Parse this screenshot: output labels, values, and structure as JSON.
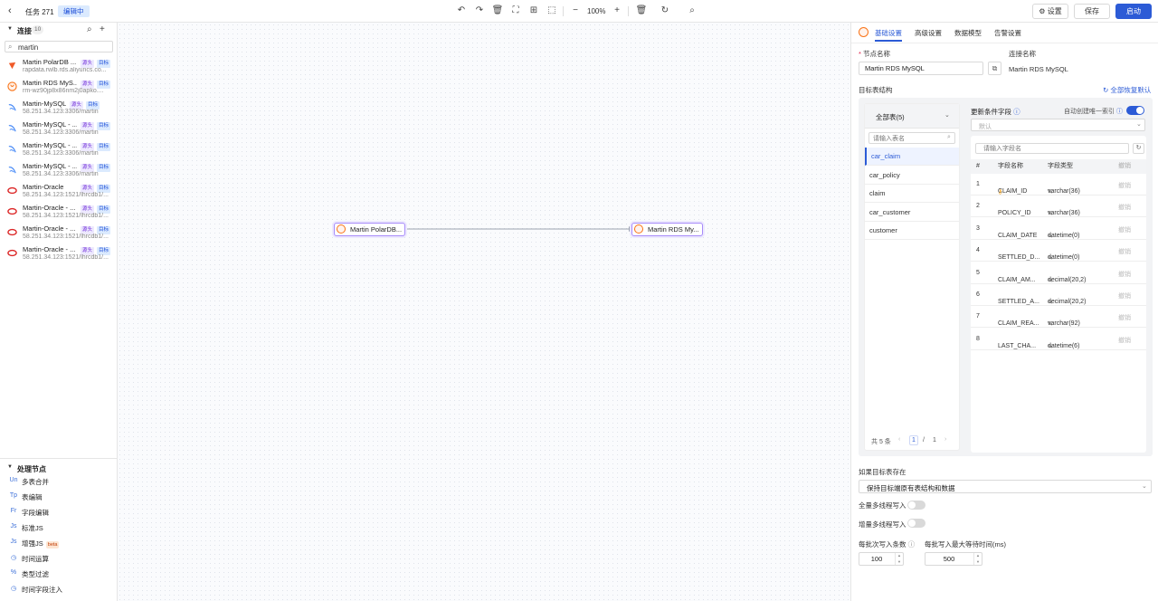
{
  "header": {
    "title": "任务 271",
    "status": "编辑中",
    "zoom": "100%",
    "settings_label": "设置",
    "save_label": "保存",
    "start_label": "启动"
  },
  "connections": {
    "label": "连接",
    "count": "10",
    "search_value": "martin",
    "items": [
      {
        "name": "Martin PolarDB ...",
        "tags": [
          "源头",
          "目标"
        ],
        "addr": "rapdata.rwlb.rds.aliyuncs.co..."
      },
      {
        "name": "Martin RDS MyS...",
        "tags": [
          "源头",
          "目标"
        ],
        "addr": "rm-wz90jp8x86nm2j0apko...."
      },
      {
        "name": "Martin-MySQL",
        "tags": [
          "源头",
          "目标"
        ],
        "addr": "58.251.34.123:3306/martin"
      },
      {
        "name": "Martin-MySQL - ...",
        "tags": [
          "源头",
          "目标"
        ],
        "addr": "58.251.34.123:3306/martin"
      },
      {
        "name": "Martin-MySQL - ...",
        "tags": [
          "源头",
          "目标"
        ],
        "addr": "58.251.34.123:3306/martin"
      },
      {
        "name": "Martin-MySQL - ...",
        "tags": [
          "源头",
          "目标"
        ],
        "addr": "58.251.34.123:3306/martin"
      },
      {
        "name": "Martin-Oracle",
        "tags": [
          "源头",
          "目标"
        ],
        "addr": "58.251.34.123:1521/lhrcdb1/..."
      },
      {
        "name": "Martin-Oracle - ...",
        "tags": [
          "源头",
          "目标"
        ],
        "addr": "58.251.34.123:1521/lhrcdb1/..."
      },
      {
        "name": "Martin-Oracle - ...",
        "tags": [
          "源头",
          "目标"
        ],
        "addr": "58.251.34.123:1521/lhrcdb1/..."
      },
      {
        "name": "Martin-Oracle - ...",
        "tags": [
          "源头",
          "目标"
        ],
        "addr": "58.251.34.123:1521/lhrcdb1/..."
      }
    ]
  },
  "processing": {
    "label": "处理节点",
    "items": [
      {
        "icon": "Un",
        "label": "多表合并"
      },
      {
        "icon": "Tp",
        "label": "表编辑"
      },
      {
        "icon": "Fr",
        "label": "字段编辑"
      },
      {
        "icon": "Js",
        "label": "标准JS"
      },
      {
        "icon": "Js",
        "label": "增强JS",
        "badge": "beta"
      },
      {
        "icon": "◷",
        "label": "时间运算"
      },
      {
        "icon": "%",
        "label": "类型过滤"
      },
      {
        "icon": "◷",
        "label": "时间字段注入"
      }
    ]
  },
  "canvas": {
    "source_node": "Martin PolarDB...",
    "target_node": "Martin RDS My..."
  },
  "panel": {
    "tabs": [
      "基础设置",
      "高级设置",
      "数据模型",
      "告警设置"
    ],
    "node_name_label": "节点名称",
    "node_name_value": "Martin RDS MySQL",
    "conn_name_label": "连接名称",
    "conn_name_value": "Martin RDS MySQL",
    "target_struct_label": "目标表结构",
    "restore_all": "全部恢复默认",
    "table_filter": "全部表(5)",
    "table_search_placeholder": "请输入表名",
    "tables": [
      "car_claim",
      "car_policy",
      "claim",
      "car_customer",
      "customer"
    ],
    "pagination": {
      "total": "共 5 条",
      "current": "1",
      "sep": "/",
      "pages": "1"
    },
    "update_field_label": "更新条件字段",
    "auto_index_label": "自动创建唯一索引",
    "update_default": "默认",
    "field_search_placeholder": "请输入字段名",
    "col_headers": [
      "#",
      "字段名称",
      "字段类型",
      "撤销"
    ],
    "fields": [
      {
        "n": "1",
        "name": "CLAIM_ID",
        "type": "varchar(36)",
        "key": true
      },
      {
        "n": "2",
        "name": "POLICY_ID",
        "type": "varchar(36)"
      },
      {
        "n": "3",
        "name": "CLAIM_DATE",
        "type": "datetime(0)"
      },
      {
        "n": "4",
        "name": "SETTLED_D...",
        "type": "datetime(0)"
      },
      {
        "n": "5",
        "name": "CLAIM_AM...",
        "type": "decimal(20,2)"
      },
      {
        "n": "6",
        "name": "SETTLED_A...",
        "type": "decimal(20,2)"
      },
      {
        "n": "7",
        "name": "CLAIM_REA...",
        "type": "varchar(92)"
      },
      {
        "n": "8",
        "name": "LAST_CHA...",
        "type": "datetime(6)"
      }
    ],
    "undo_label": "撤销",
    "exists_label": "如果目标表存在",
    "exists_value": "保持目标端原有表结构和数据",
    "full_multi_label": "全量多线程写入",
    "incr_multi_label": "增量多线程写入",
    "batch_count_label": "每批次写入条数",
    "batch_wait_label": "每批写入最大等待时间(ms)",
    "batch_count_value": "100",
    "batch_wait_value": "500"
  }
}
